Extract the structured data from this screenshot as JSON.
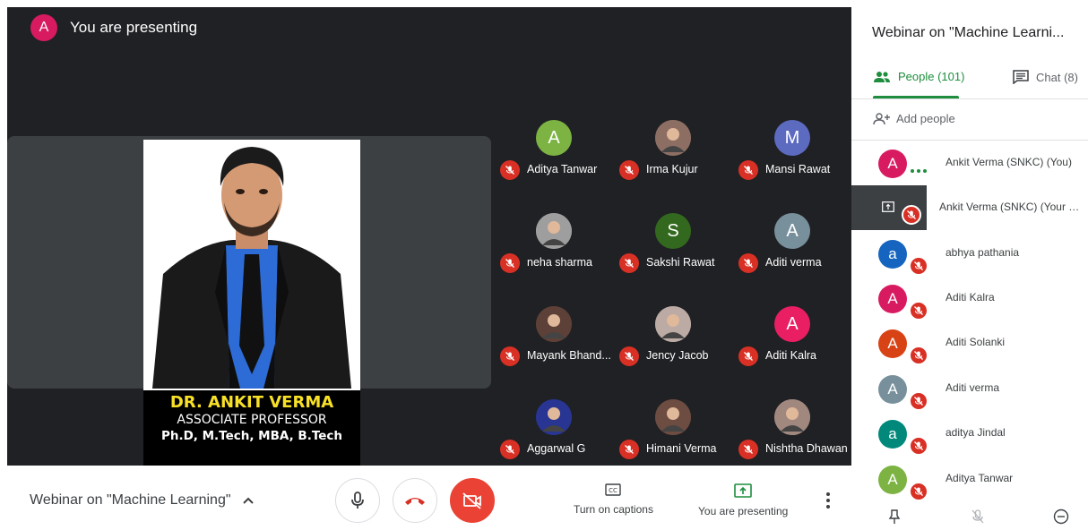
{
  "presenting_banner": {
    "avatar_letter": "A",
    "text": "You are presenting"
  },
  "slide": {
    "name": "DR. ANKIT VERMA",
    "title": "ASSOCIATE PROFESSOR",
    "degrees": "Ph.D, M.Tech, MBA, B.Tech"
  },
  "grid": [
    {
      "name": "Aditya Tanwar",
      "letter": "A",
      "color": "#7cb342",
      "photo": false
    },
    {
      "name": "Irma Kujur",
      "letter": "",
      "color": "#8d6e63",
      "photo": true
    },
    {
      "name": "Mansi Rawat",
      "letter": "M",
      "color": "#5c6bc0",
      "photo": false
    },
    {
      "name": "neha sharma",
      "letter": "",
      "color": "#9e9e9e",
      "photo": true
    },
    {
      "name": "Sakshi Rawat",
      "letter": "S",
      "color": "#33691e",
      "photo": false
    },
    {
      "name": "Aditi verma",
      "letter": "A",
      "color": "#78909c",
      "photo": false
    },
    {
      "name": "Mayank Bhand...",
      "letter": "",
      "color": "#5d4037",
      "photo": true
    },
    {
      "name": "Jency Jacob",
      "letter": "",
      "color": "#bcaaa4",
      "photo": true
    },
    {
      "name": "Aditi Kalra",
      "letter": "A",
      "color": "#e91e63",
      "photo": false
    },
    {
      "name": "Aggarwal G",
      "letter": "",
      "color": "#283593",
      "photo": true
    },
    {
      "name": "Himani Verma",
      "letter": "",
      "color": "#6d4c41",
      "photo": true
    },
    {
      "name": "Nishtha Dhawan",
      "letter": "",
      "color": "#a1887f",
      "photo": true
    }
  ],
  "bottom_bar": {
    "meeting_title": "Webinar on \"Machine Learning\"",
    "captions_label": "Turn on captions",
    "presenting_label": "You are presenting"
  },
  "side_panel": {
    "title": "Webinar on \"Machine Learni...",
    "people_tab": "People (101)",
    "chat_tab": "Chat (8)",
    "add_people": "Add people",
    "participants": [
      {
        "name": "Ankit Verma (SNKC) (You)",
        "letter": "A",
        "color": "#d81b60"
      },
      {
        "name": "Ankit Verma (SNKC) (Your Pre...",
        "letter": "",
        "color": "#3c4043"
      },
      {
        "name": "abhya pathania",
        "letter": "a",
        "color": "#1565c0"
      },
      {
        "name": "Aditi Kalra",
        "letter": "A",
        "color": "#d81b60"
      },
      {
        "name": "Aditi Solanki",
        "letter": "A",
        "color": "#d84315"
      },
      {
        "name": "Aditi verma",
        "letter": "A",
        "color": "#78909c"
      },
      {
        "name": "aditya Jindal",
        "letter": "a",
        "color": "#00897b"
      },
      {
        "name": "Aditya Tanwar",
        "letter": "A",
        "color": "#7cb342"
      }
    ]
  },
  "colors": {
    "accent_green": "#1e8e3e",
    "mute_red": "#d93025",
    "stage_dark": "#202124"
  }
}
